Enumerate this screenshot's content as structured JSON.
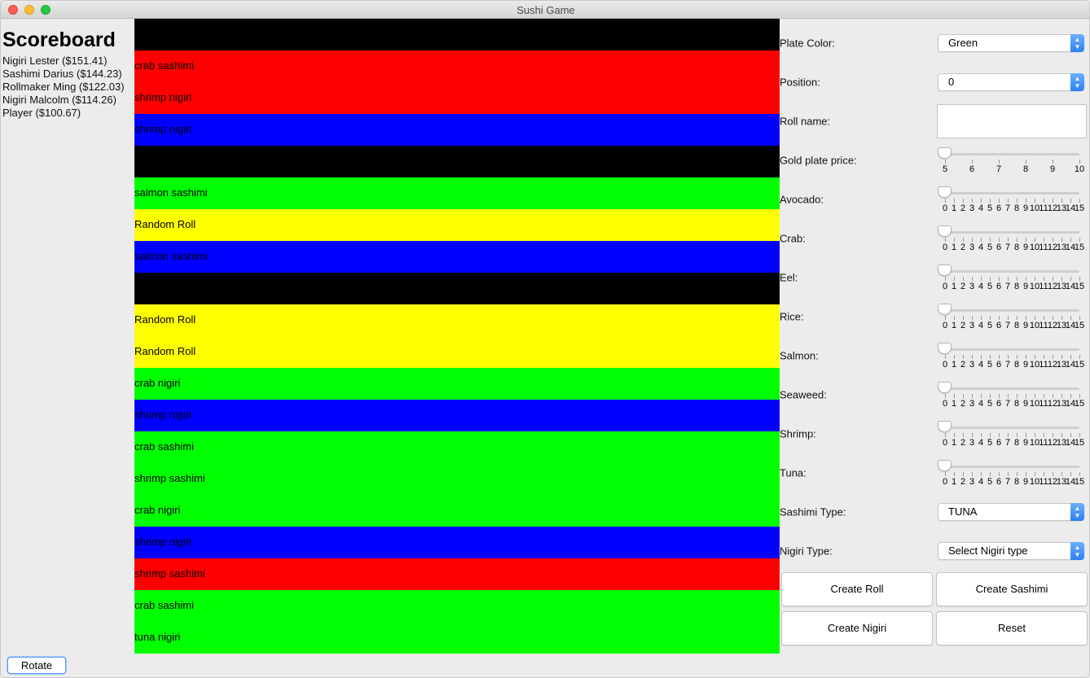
{
  "window": {
    "title": "Sushi Game"
  },
  "scoreboard": {
    "title": "Scoreboard",
    "entries": [
      "Nigiri Lester ($151.41)",
      "Sashimi Darius ($144.23)",
      "Rollmaker Ming ($122.03)",
      "Nigiri Malcolm ($114.26)",
      "Player ($100.67)"
    ]
  },
  "colors": {
    "black": "#000000",
    "red": "#ff0000",
    "blue": "#0000ff",
    "green": "#00ff00",
    "yellow": "#ffff00"
  },
  "belt": [
    {
      "color": "black",
      "label": ""
    },
    {
      "color": "red",
      "label": "crab sashimi"
    },
    {
      "color": "red",
      "label": "shrimp nigiri"
    },
    {
      "color": "blue",
      "label": "shrimp nigiri"
    },
    {
      "color": "black",
      "label": ""
    },
    {
      "color": "green",
      "label": "salmon sashimi"
    },
    {
      "color": "yellow",
      "label": "Random Roll"
    },
    {
      "color": "blue",
      "label": "salmon sashimi"
    },
    {
      "color": "black",
      "label": ""
    },
    {
      "color": "yellow",
      "label": "Random Roll"
    },
    {
      "color": "yellow",
      "label": "Random Roll"
    },
    {
      "color": "green",
      "label": "crab nigiri"
    },
    {
      "color": "blue",
      "label": "shrimp nigiri"
    },
    {
      "color": "green",
      "label": "crab sashimi"
    },
    {
      "color": "green",
      "label": "shrimp sashimi"
    },
    {
      "color": "green",
      "label": "crab nigiri"
    },
    {
      "color": "blue",
      "label": "shrimp nigiri"
    },
    {
      "color": "red",
      "label": "shrimp sashimi"
    },
    {
      "color": "green",
      "label": "crab sashimi"
    },
    {
      "color": "green",
      "label": "tuna nigiri"
    }
  ],
  "controls": {
    "plate_color": {
      "label": "Plate Color:",
      "value": "Green"
    },
    "position": {
      "label": "Position:",
      "value": "0"
    },
    "roll_name": {
      "label": "Roll name:",
      "value": ""
    },
    "gold_price": {
      "label": "Gold plate price:",
      "min": 5,
      "max": 10,
      "value": 5,
      "tick_labels": [
        "5",
        "6",
        "7",
        "8",
        "9",
        "10"
      ]
    },
    "ingredients": [
      {
        "label": "Avocado:",
        "value": 0
      },
      {
        "label": "Crab:",
        "value": 0
      },
      {
        "label": "Eel:",
        "value": 0
      },
      {
        "label": "Rice:",
        "value": 0
      },
      {
        "label": "Salmon:",
        "value": 0
      },
      {
        "label": "Seaweed:",
        "value": 0
      },
      {
        "label": "Shrimp:",
        "value": 0
      },
      {
        "label": "Tuna:",
        "value": 0
      }
    ],
    "ingredient_scale": {
      "min": 0,
      "max": 15,
      "tick_labels": [
        "0",
        "1",
        "2",
        "3",
        "4",
        "5",
        "6",
        "7",
        "8",
        "9",
        "10",
        "11",
        "12",
        "13",
        "14",
        "15"
      ]
    },
    "sashimi_type": {
      "label": "Sashimi Type:",
      "value": "TUNA"
    },
    "nigiri_type": {
      "label": "Nigiri Type:",
      "value": "Select Nigiri type"
    },
    "buttons": {
      "create_roll": "Create Roll",
      "create_sashimi": "Create Sashimi",
      "create_nigiri": "Create Nigiri",
      "reset": "Reset"
    }
  },
  "rotate_button": "Rotate"
}
